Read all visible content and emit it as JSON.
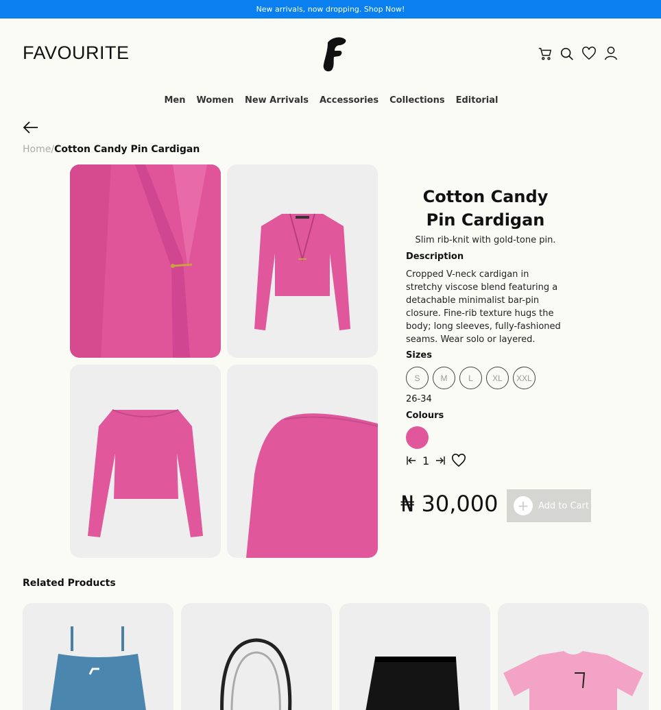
{
  "promo": {
    "text": "New arrivals, now dropping. Shop Now!"
  },
  "header": {
    "brand": "FAVOURITE"
  },
  "nav": [
    "Men",
    "Women",
    "New Arrivals",
    "Accessories",
    "Collections",
    "Editorial"
  ],
  "breadcrumb": {
    "home": "Home",
    "separator": "/",
    "current": "Cotton Candy Pin Cardigan"
  },
  "product": {
    "title": "Cotton Candy Pin Cardigan",
    "subtitle": "Slim rib-knit with gold-tone pin.",
    "description_label": "Description",
    "description": "Cropped V-neck cardigan in stretchy viscose blend featuring a detachable minimalist bar-pin closure. Fine-rib texture hugs the body; long sleeves, fully-fashioned seams. Wear solo or layered.",
    "sizes_label": "Sizes",
    "sizes": [
      "S",
      "M",
      "L",
      "XL",
      "XXL"
    ],
    "size_range": "26-34",
    "colours_label": "Colours",
    "colour": "#e0579b",
    "quantity": "1",
    "price": "₦ 30,000",
    "add_to_cart": "Add to Cart"
  },
  "related": {
    "title": "Related Products"
  },
  "colors": {
    "promo": "#0a80f0",
    "background": "#fbfbf5",
    "accent_pink": "#e0549a"
  }
}
